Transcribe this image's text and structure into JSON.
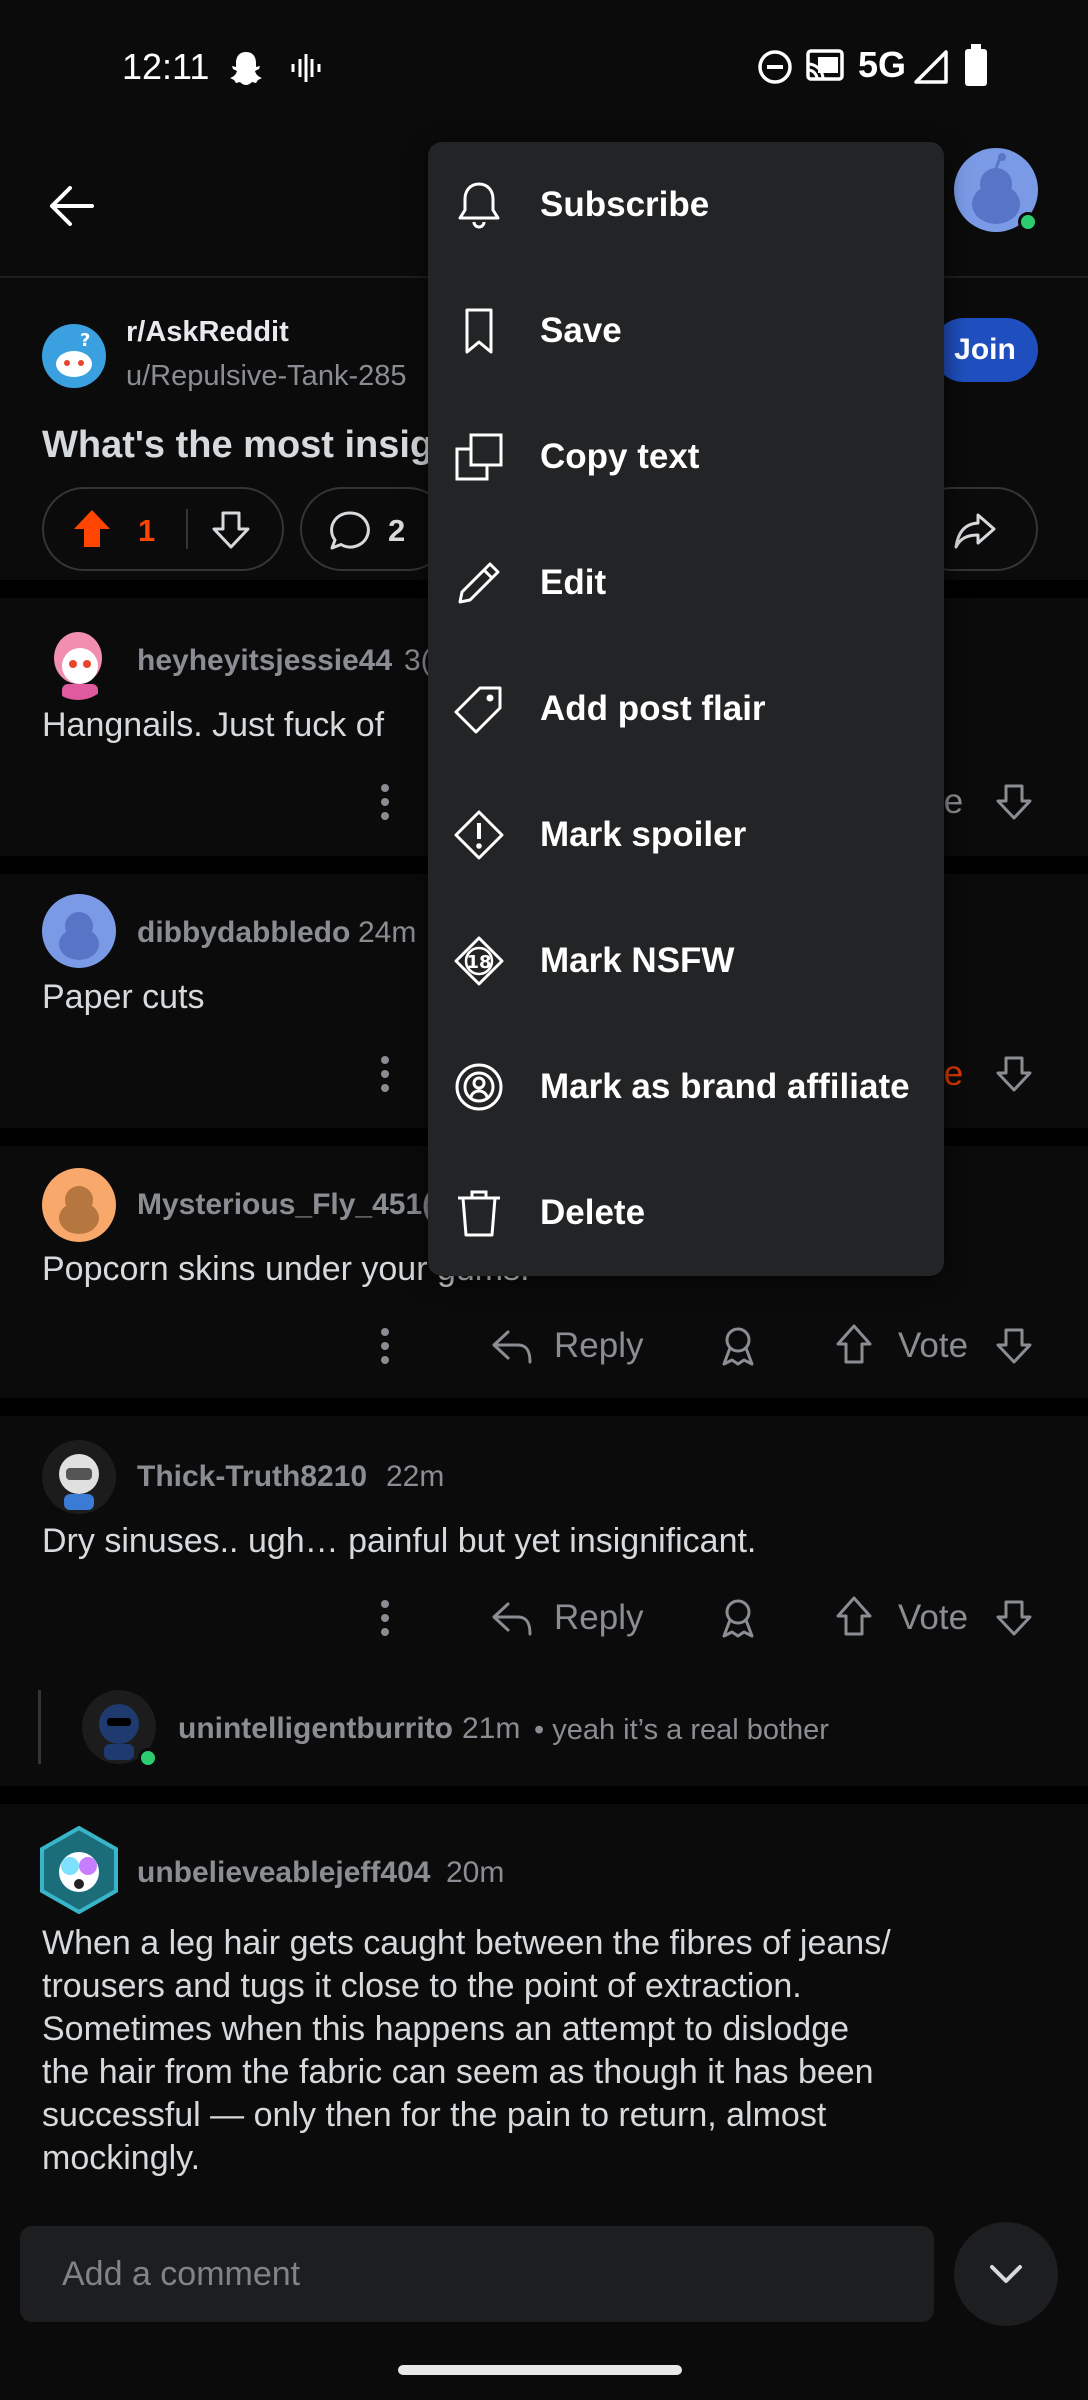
{
  "status_bar": {
    "time": "12:11",
    "network": "5G"
  },
  "post": {
    "subreddit": "r/AskReddit",
    "author": "u/Repulsive-Tank-285",
    "title": "What's the most insig",
    "join_label": "Join",
    "upvotes": "1",
    "comments": "2"
  },
  "menu": {
    "items": [
      {
        "label": "Subscribe",
        "icon": "bell-icon"
      },
      {
        "label": "Save",
        "icon": "bookmark-icon"
      },
      {
        "label": "Copy text",
        "icon": "copy-icon"
      },
      {
        "label": "Edit",
        "icon": "pencil-icon"
      },
      {
        "label": "Add post flair",
        "icon": "tag-icon"
      },
      {
        "label": "Mark spoiler",
        "icon": "spoiler-icon"
      },
      {
        "label": "Mark NSFW",
        "icon": "nsfw-18-icon"
      },
      {
        "label": "Mark as brand affiliate",
        "icon": "brand-affiliate-icon"
      },
      {
        "label": "Delete",
        "icon": "trash-icon"
      }
    ]
  },
  "comments": [
    {
      "user": "heyheyitsjessie44",
      "time": "3(",
      "body": "Hangnails.  Just fuck of",
      "vote_label": "te"
    },
    {
      "user": "dibbydabbledo",
      "time": "24m",
      "body": "Paper cuts",
      "vote_label": "te"
    },
    {
      "user": "Mysterious_Fly_451(",
      "time": "",
      "body": "Popcorn skins under your gums.",
      "reply_label": "Reply",
      "vote_label": "Vote"
    },
    {
      "user": "Thick-Truth8210",
      "time": "22m",
      "body": "Dry sinuses.. ugh… painful but yet insignificant.",
      "reply_label": "Reply",
      "vote_label": "Vote"
    },
    {
      "user": "unintelligentburrito",
      "time": "21m",
      "preview": "• yeah it’s a real bother"
    },
    {
      "user": "unbelieveablejeff404",
      "time": "20m",
      "body_lines": [
        "When a leg hair gets caught between the fibres of jeans/",
        "trousers and tugs it close to the point of extraction.",
        "Sometimes when this happens an attempt to dislodge",
        "the hair from the fabric can seem as though it has been",
        "successful — only then for the pain to return, almost",
        "mockingly."
      ]
    }
  ],
  "comment_input": {
    "placeholder": "Add a comment"
  },
  "colors": {
    "upvote_active": "#ff4500",
    "vote_red": "#d93a00",
    "join_blue": "#1f4fbf",
    "online_green": "#2ecc71"
  }
}
